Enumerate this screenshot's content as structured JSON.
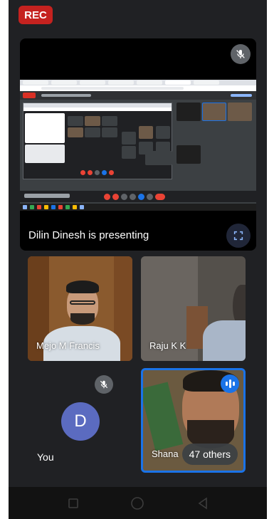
{
  "recording": {
    "label": "REC"
  },
  "presentation": {
    "status_text": "Dilin Dinesh is presenting"
  },
  "participants": [
    {
      "name": "Mejo M Francis"
    },
    {
      "name": "Raju K K"
    },
    {
      "name": "Shana"
    }
  ],
  "self": {
    "avatar_letter": "D",
    "label": "You"
  },
  "overflow": {
    "label": "47 others"
  },
  "colors": {
    "accent": "#1a73e8",
    "rec": "#c5221f",
    "background": "#202124"
  }
}
